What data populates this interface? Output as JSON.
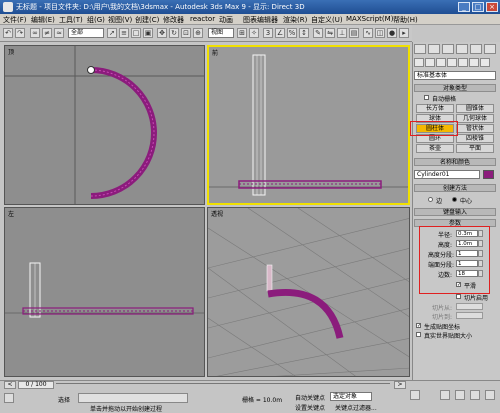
{
  "window": {
    "title": "无标题 - 项目文件夹: D:\\用户\\我的文档\\3dsmax - Autodesk 3ds Max 9 - 显示: Direct 3D",
    "controls": [
      "_",
      "□",
      "×"
    ]
  },
  "menubar": [
    "文件(F)",
    "编辑(E)",
    "工具(T)",
    "组(G)",
    "视图(V)",
    "创建(C)",
    "修改器",
    "reactor",
    "动画",
    "图表编辑器",
    "渲染(R)",
    "自定义(U)",
    "MAXScript(M)",
    "帮助(H)"
  ],
  "toolbar": {
    "selection_filter": "全部",
    "view_combo": "视图"
  },
  "viewports": [
    {
      "label": "顶",
      "id": "top"
    },
    {
      "label": "前",
      "id": "front"
    },
    {
      "label": "左",
      "id": "left"
    },
    {
      "label": "透视",
      "id": "persp"
    }
  ],
  "panel": {
    "category": "标准基本体",
    "object_type_title": "对象类型",
    "auto_grid": "自动栅格",
    "buttons": [
      "长方体",
      "圆锥体",
      "球体",
      "几何球体",
      "圆柱体",
      "管状体",
      "圆环",
      "四棱锥",
      "茶壶",
      "平面"
    ],
    "name_color_title": "名称和颜色",
    "object_name": "Cylinder01",
    "creation_method_title": "创建方法",
    "creation_methods": [
      "边",
      "中心"
    ],
    "keyboard_entry_title": "键盘输入",
    "parameters_title": "参数",
    "params": [
      {
        "label": "半径:",
        "value": "0.3m"
      },
      {
        "label": "高度:",
        "value": "1.0m"
      },
      {
        "label": "高度分段:",
        "value": "1"
      },
      {
        "label": "端面分段:",
        "value": "1"
      },
      {
        "label": "边数:",
        "value": "18"
      }
    ],
    "smooth": "平滑",
    "slice_on": "切片启用",
    "slice_from": "切片从:",
    "slice_to": "切片到:",
    "gen_mapping": "生成贴图坐标",
    "real_world": "真实世界贴图大小"
  },
  "status": {
    "frame": "0 / 100",
    "selected": "选择",
    "grid": "栅格 = 10.0m",
    "auto_key": "自动关键点",
    "selected_obj": "选定对象",
    "set_key": "设置关键点",
    "key_filters": "关键点过滤器...",
    "hint": "单击并拖动以开始创建过程"
  },
  "colors": {
    "title_bar": "#2a5ea8",
    "object_magenta": "#8b1c7c",
    "selection_yellow": "#f0e000",
    "highlight_red": "#e02020",
    "active_button": "#f5b800"
  }
}
